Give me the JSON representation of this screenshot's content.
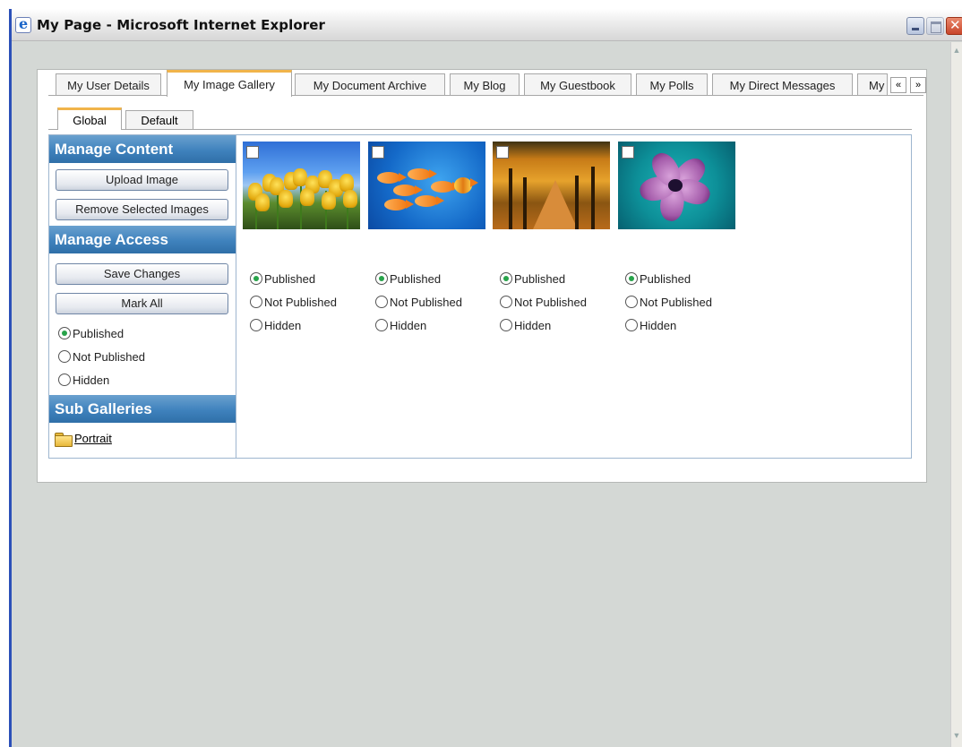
{
  "window": {
    "title": "My Page - Microsoft Internet Explorer"
  },
  "tabs": [
    {
      "label": "My User Details"
    },
    {
      "label": "My Image Gallery",
      "active": true
    },
    {
      "label": "My Document Archive"
    },
    {
      "label": "My Blog"
    },
    {
      "label": "My Guestbook"
    },
    {
      "label": "My Polls"
    },
    {
      "label": "My Direct Messages"
    },
    {
      "label": "My"
    }
  ],
  "tab_scroll": {
    "left": "«",
    "right": "»"
  },
  "sub_tabs": [
    {
      "label": "Global",
      "active": true
    },
    {
      "label": "Default"
    }
  ],
  "sidebar": {
    "manage_content": {
      "title": "Manage Content",
      "buttons": [
        "Upload Image",
        "Remove Selected Images"
      ]
    },
    "manage_access": {
      "title": "Manage Access",
      "buttons": [
        "Save Changes",
        "Mark All"
      ],
      "options": [
        {
          "label": "Published",
          "checked": true
        },
        {
          "label": "Not Published",
          "checked": false
        },
        {
          "label": "Hidden",
          "checked": false
        }
      ]
    },
    "sub_galleries": {
      "title": "Sub Galleries",
      "folders": [
        {
          "label": "Portrait"
        }
      ]
    }
  },
  "gallery": {
    "images": [
      {
        "subject": "tulips",
        "options": [
          "Published",
          "Not Published",
          "Hidden"
        ],
        "selected": "Published"
      },
      {
        "subject": "goldfish",
        "options": [
          "Published",
          "Not Published",
          "Hidden"
        ],
        "selected": "Published"
      },
      {
        "subject": "autumn-road",
        "options": [
          "Published",
          "Not Published",
          "Hidden"
        ],
        "selected": "Published"
      },
      {
        "subject": "purple-flower",
        "options": [
          "Published",
          "Not Published",
          "Hidden"
        ],
        "selected": "Published"
      }
    ]
  },
  "colors": {
    "section_header": "#3f82bd",
    "tab_active_accent": "#f1b44a",
    "radio_selected": "#27a34a",
    "page_background": "#d4d8d5"
  }
}
